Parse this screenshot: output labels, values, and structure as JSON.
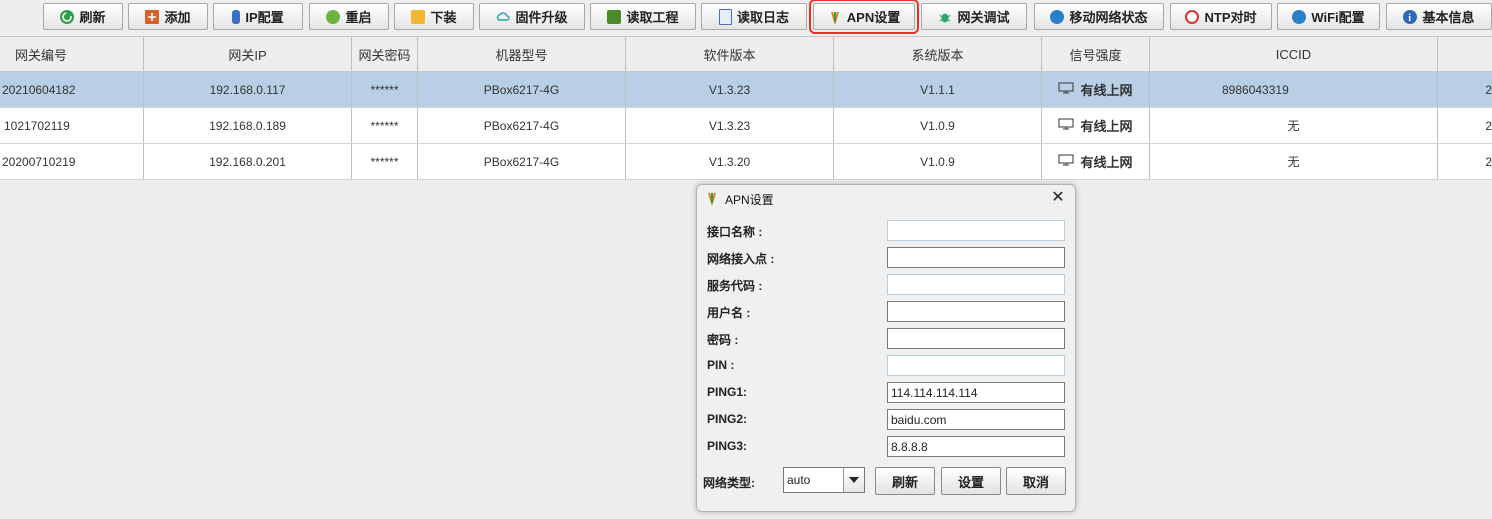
{
  "toolbar": {
    "buttons": [
      {
        "label": "刷新",
        "icon": "refresh-icon"
      },
      {
        "label": "添加",
        "icon": "add-icon"
      },
      {
        "label": "IP配置",
        "icon": "ip-config-icon"
      },
      {
        "label": "重启",
        "icon": "restart-icon"
      },
      {
        "label": "下装",
        "icon": "download-folder-icon"
      },
      {
        "label": "固件升级",
        "icon": "cloud-upgrade-icon"
      },
      {
        "label": "读取工程",
        "icon": "project-icon"
      },
      {
        "label": "读取日志",
        "icon": "log-icon"
      },
      {
        "label": "APN设置",
        "icon": "apn-icon"
      },
      {
        "label": "网关调试",
        "icon": "debug-bug-icon"
      },
      {
        "label": "移动网络状态",
        "icon": "mobile-signal-icon"
      },
      {
        "label": "NTP对时",
        "icon": "clock-icon"
      },
      {
        "label": "WiFi配置",
        "icon": "wifi-icon"
      },
      {
        "label": "基本信息",
        "icon": "info-icon"
      }
    ]
  },
  "table": {
    "columns": [
      "网关编号",
      "网关IP",
      "网关密码",
      "机器型号",
      "软件版本",
      "系统版本",
      "信号强度",
      "ICCID",
      ""
    ],
    "rows": [
      {
        "id": "20210604182",
        "ip": "192.168.0.117",
        "password": "******",
        "model": "PBox6217-4G",
        "software": "V1.3.23",
        "system": "V1.1.1",
        "signal": "有线上网",
        "iccid": "8986043319",
        "extra": "2"
      },
      {
        "id": "1021702119",
        "ip": "192.168.0.189",
        "password": "******",
        "model": "PBox6217-4G",
        "software": "V1.3.23",
        "system": "V1.0.9",
        "signal": "有线上网",
        "iccid": "无",
        "extra": "2"
      },
      {
        "id": "20200710219",
        "ip": "192.168.0.201",
        "password": "******",
        "model": "PBox6217-4G",
        "software": "V1.3.20",
        "system": "V1.0.9",
        "signal": "有线上网",
        "iccid": "无",
        "extra": "2"
      }
    ]
  },
  "dialog": {
    "title": "APN设置",
    "close": "✕",
    "fields": [
      {
        "label": "接口名称 :",
        "value": ""
      },
      {
        "label": "网络接入点 :",
        "value": ""
      },
      {
        "label": "服务代码 :",
        "value": ""
      },
      {
        "label": "用户名 :",
        "value": ""
      },
      {
        "label": "密码 :",
        "value": ""
      },
      {
        "label": "PIN :",
        "value": ""
      },
      {
        "label": "PING1:",
        "value": "114.114.114.114"
      },
      {
        "label": "PING2:",
        "value": "baidu.com"
      },
      {
        "label": "PING3:",
        "value": "8.8.8.8"
      }
    ],
    "network_type_label": "网络类型:",
    "network_type_value": "auto",
    "refresh_label": "刷新",
    "set_label": "设置",
    "cancel_label": "取消"
  },
  "colors": {
    "selected_row": "#b8cfe5",
    "highlight": "#e8302c"
  }
}
